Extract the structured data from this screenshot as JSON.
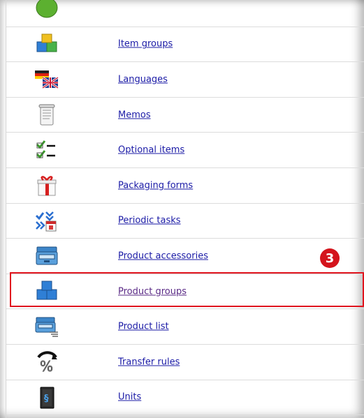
{
  "items": [
    {
      "label": "",
      "icon": "green-circle-icon"
    },
    {
      "label": "Item groups",
      "icon": "item-groups-cubes-icon"
    },
    {
      "label": "Languages",
      "icon": "languages-flags-icon"
    },
    {
      "label": "Memos",
      "icon": "memo-scroll-icon"
    },
    {
      "label": "Optional items",
      "icon": "checklist-icon"
    },
    {
      "label": "Packaging forms",
      "icon": "gift-box-icon"
    },
    {
      "label": "Periodic tasks",
      "icon": "periodic-tasks-icon"
    },
    {
      "label": "Product accessories",
      "icon": "product-accessories-icon"
    },
    {
      "label": "Product groups",
      "icon": "product-groups-cubes-icon"
    },
    {
      "label": "Product list",
      "icon": "product-list-icon"
    },
    {
      "label": "Transfer rules",
      "icon": "percent-transfer-icon"
    },
    {
      "label": "Units",
      "icon": "units-book-icon"
    }
  ],
  "callout": {
    "number": "3"
  },
  "colors": {
    "link": "#1a1aa6",
    "highlight": "#e0141e",
    "badge": "#d4141c"
  }
}
